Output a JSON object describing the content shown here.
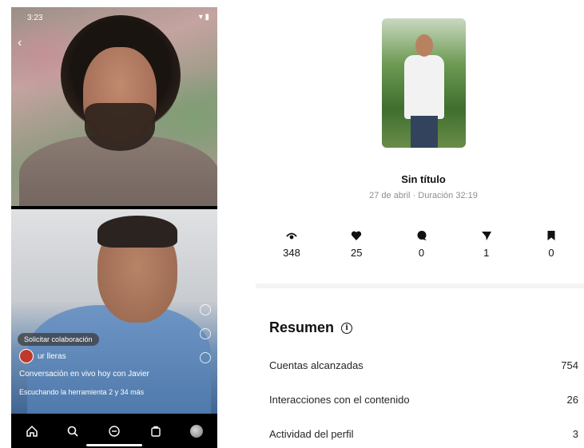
{
  "phone": {
    "status_time": "3:23",
    "status_icons": "▾ ▮",
    "overlay_pill": "Solicitar colaboración",
    "username": "ur lleras",
    "caption": "Conversación en vivo hoy con Javier",
    "audio_line": "Escuchando la herramienta 2 y 34 más",
    "nav": [
      "home-icon",
      "search-icon",
      "reels-icon",
      "shop-icon",
      "profile-avatar"
    ]
  },
  "post": {
    "title": "Sin título",
    "meta": "27 de abril · Duración 32:19"
  },
  "metrics": [
    {
      "icon": "eye-icon",
      "value": "348"
    },
    {
      "icon": "heart-icon",
      "value": "25"
    },
    {
      "icon": "comment-icon",
      "value": "0"
    },
    {
      "icon": "share-icon",
      "value": "1"
    },
    {
      "icon": "save-icon",
      "value": "0"
    }
  ],
  "summary": {
    "title": "Resumen",
    "rows": [
      {
        "label": "Cuentas alcanzadas",
        "value": "754"
      },
      {
        "label": "Interacciones con el contenido",
        "value": "26"
      },
      {
        "label": "Actividad del perfil",
        "value": "3"
      }
    ]
  }
}
